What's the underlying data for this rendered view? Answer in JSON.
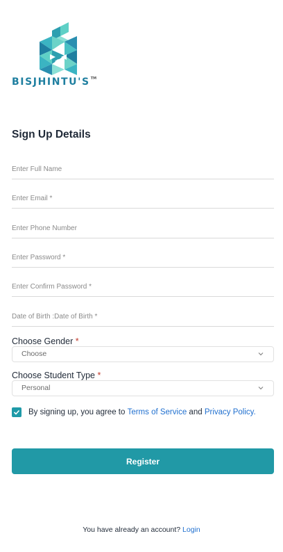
{
  "brand": {
    "name": "BISJHINTU'S",
    "trademark": "TM",
    "color": "#1f7fa0"
  },
  "form": {
    "title": "Sign Up Details",
    "fields": {
      "full_name": {
        "placeholder": "Enter Full Name"
      },
      "email": {
        "placeholder": "Enter Email *"
      },
      "phone": {
        "placeholder": "Enter Phone Number"
      },
      "password": {
        "placeholder": "Enter Password *"
      },
      "confirm_password": {
        "placeholder": "Enter Confirm Password *"
      },
      "dob": {
        "placeholder": "Date of Birth :Date of Birth *"
      }
    },
    "gender": {
      "label": "Choose Gender",
      "required_mark": "*",
      "selected": "Choose"
    },
    "student_type": {
      "label": "Choose Student Type",
      "required_mark": "*",
      "selected": "Personal"
    },
    "terms": {
      "checked": true,
      "prefix": "By signing up, you agree to",
      "tos_link": "Terms of Service",
      "and_text": "and",
      "privacy_link": "Privacy Policy."
    },
    "register_label": "Register",
    "footer": {
      "text": "You have already an account?",
      "login_link": "Login"
    }
  },
  "colors": {
    "accent": "#2199a6",
    "link": "#1f6fcf",
    "required": "#c0392b"
  },
  "icons": {
    "logo": "cube-logo-icon",
    "chevron": "chevron-down-icon",
    "check": "check-icon"
  }
}
